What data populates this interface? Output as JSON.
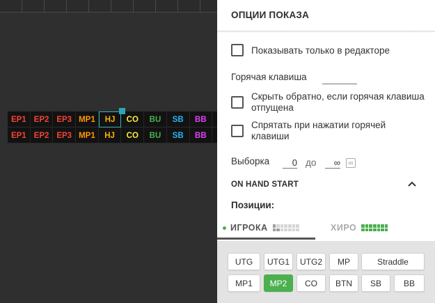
{
  "canvas": {
    "rows": [
      [
        {
          "label": "EP1",
          "color": "#f44336"
        },
        {
          "label": "EP2",
          "color": "#f44336"
        },
        {
          "label": "EP3",
          "color": "#f44336"
        },
        {
          "label": "MP1",
          "color": "#ff9800"
        },
        {
          "label": "HJ",
          "color": "#ffb300",
          "selected": true
        },
        {
          "label": "CO",
          "color": "#ffeb3b"
        },
        {
          "label": "BU",
          "color": "#4caf50"
        },
        {
          "label": "SB",
          "color": "#29b6f6"
        },
        {
          "label": "BB",
          "color": "#e040fb"
        }
      ],
      [
        {
          "label": "EP1",
          "color": "#f44336"
        },
        {
          "label": "EP2",
          "color": "#f44336"
        },
        {
          "label": "EP3",
          "color": "#f44336"
        },
        {
          "label": "MP1",
          "color": "#ff9800"
        },
        {
          "label": "HJ",
          "color": "#ffb300"
        },
        {
          "label": "CO",
          "color": "#ffeb3b"
        },
        {
          "label": "BU",
          "color": "#4caf50"
        },
        {
          "label": "SB",
          "color": "#29b6f6"
        },
        {
          "label": "BB",
          "color": "#e040fb"
        }
      ]
    ]
  },
  "panel": {
    "title": "ОПЦИИ ПОКАЗА",
    "show_only_editor": "Показывать только в редакторе",
    "hotkey_label": "Горячая клавиша",
    "hide_on_release": "Скрыть обратно, если горячая клавиша отпущена",
    "hide_on_press": "Спрятать при нажатии горячей клавиши",
    "sample_label": "Выборка",
    "sample_from": "0",
    "sample_to_label": "до",
    "sample_to": "∞",
    "infinity_icon": "∞",
    "section_head": "ON HAND START",
    "positions_label": "Позиции:",
    "tab_player": "ИГРОКА",
    "tab_hero": "ХИРО",
    "accent": "#4caf50"
  },
  "position_buttons": [
    {
      "label": "UTG",
      "active": false
    },
    {
      "label": "UTG1",
      "active": false
    },
    {
      "label": "UTG2",
      "active": false
    },
    {
      "label": "MP",
      "active": false
    },
    {
      "label": "Straddle",
      "active": false
    },
    {
      "label": "MP1",
      "active": false
    },
    {
      "label": "MP2",
      "active": true
    },
    {
      "label": "CO",
      "active": false
    },
    {
      "label": "BTN",
      "active": false
    },
    {
      "label": "SB",
      "active": false
    },
    {
      "label": "BB",
      "active": false
    }
  ]
}
